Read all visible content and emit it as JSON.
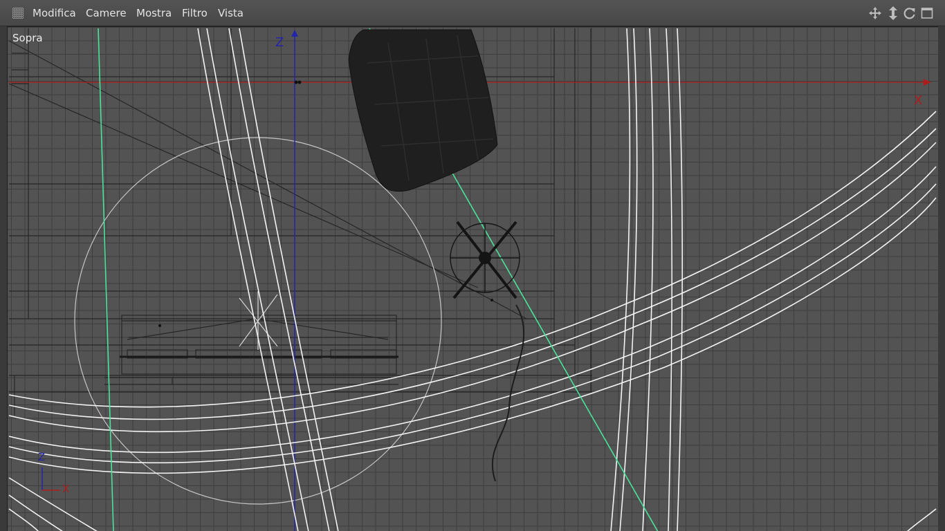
{
  "menubar": {
    "items": [
      "Modifica",
      "Camere",
      "Mostra",
      "Filtro",
      "Vista"
    ]
  },
  "viewport": {
    "view_name": "Sopra",
    "axes": {
      "z_label": "Z",
      "x_label": "X",
      "gizmo_z": "Z",
      "gizmo_x": "X"
    },
    "controls": [
      "move-icon",
      "zoom-icon",
      "rotate-icon",
      "maximize-icon"
    ]
  },
  "colors": {
    "menubar": "#4e4e4e",
    "viewport_bg": "#535353",
    "grid": "#3e3e3e",
    "x_axis": "#b01c1c",
    "z_axis": "#2020a8",
    "spline_white": "#f4f4f4",
    "spline_green": "#49e39a",
    "object_black": "#1f1f1f"
  }
}
